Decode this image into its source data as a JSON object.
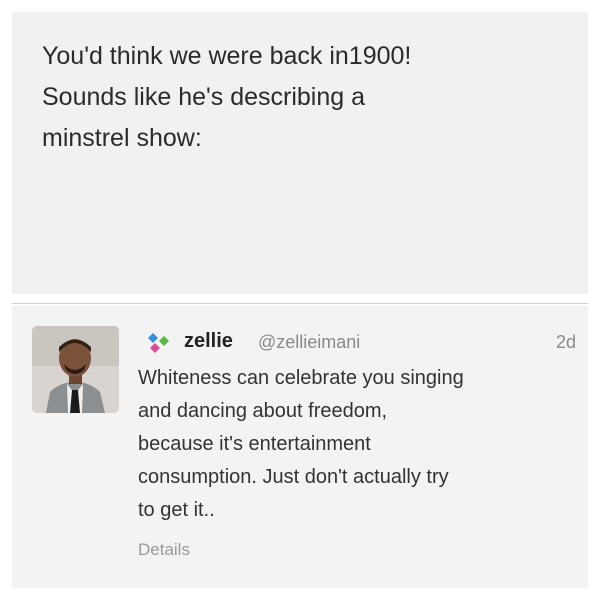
{
  "note": {
    "text": "You'd think we were back in1900!\nSounds like he's describing a\nminstrel show:"
  },
  "tweet": {
    "display_name": "zellie",
    "handle": "@zellieimani",
    "timestamp": "2d",
    "body": "Whiteness can celebrate you singing\nand dancing about freedom,\nbecause it's entertainment\nconsumption. Just don't actually try\nto get it..",
    "details_label": "Details",
    "app_icon": "diamond-logo-icon",
    "colors": {
      "icon_blue": "#3b8fd8",
      "icon_green": "#58b947",
      "icon_pink": "#d94c96"
    }
  }
}
